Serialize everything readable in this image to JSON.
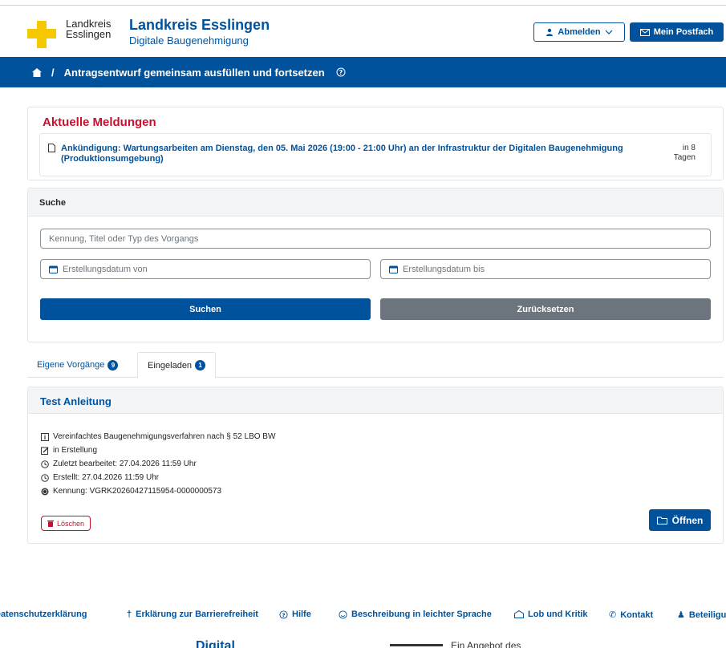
{
  "header": {
    "brand_small_line1": "Landkreis",
    "brand_small_line2": "Esslingen",
    "brand_title": "Landkreis Esslingen",
    "brand_subtitle": "Digitale Baugenehmigung",
    "logout_label": "Abmelden",
    "mailbox_label": "Mein Postfach"
  },
  "breadcrumb": {
    "separator": "/",
    "current": "Antragsentwurf gemeinsam ausfüllen und fortsetzen"
  },
  "news": {
    "title": "Aktuelle Meldungen",
    "items": [
      {
        "text": "Ankündigung: Wartungsarbeiten am Dienstag, den 05. Mai 2026 (19:00 - 21:00 Uhr) an der Infrastruktur der Digitalen Baugenehmigung (Produktionsumgebung)",
        "when_line1": "in 8",
        "when_line2": "Tagen"
      }
    ]
  },
  "search": {
    "title": "Suche",
    "query_placeholder": "Kennung, Titel oder Typ des Vorgangs",
    "date_from_placeholder": "Erstellungsdatum von",
    "date_to_placeholder": "Erstellungsdatum bis",
    "search_label": "Suchen",
    "reset_label": "Zurücksetzen"
  },
  "tabs": [
    {
      "label": "Eigene Vorgänge",
      "count": "9"
    },
    {
      "label": "Eingeladen",
      "count": "1"
    }
  ],
  "card": {
    "title": "Test Anleitung",
    "procedure": "Vereinfachtes Baugenehmigungsverfahren nach § 52 LBO BW",
    "status": "in Erstellung",
    "last_edited": "Zuletzt bearbeitet: 27.04.2026 11:59 Uhr",
    "created": "Erstellt: 27.04.2026 11:59 Uhr",
    "id": "Kennung: VGRK20260427115954-0000000573",
    "delete_label": "Löschen",
    "open_label": "Öffnen"
  },
  "footer": {
    "privacy": "Datenschutzerklärung",
    "accessibility": "Erklärung zur Barrierefreiheit",
    "help": "Hilfe",
    "easy_language": "Beschreibung in leichter Sprache",
    "feedback": "Lob und Kritik",
    "contact": "Kontakt",
    "participation": "Beteiligung"
  },
  "bottom": {
    "brand_partial": "Digital",
    "text_partial": "Ein Angebot des"
  },
  "colors": {
    "primary": "#00529c",
    "danger": "#c8102e",
    "logo_yellow": "#f6c800",
    "secondary": "#6c757d"
  }
}
